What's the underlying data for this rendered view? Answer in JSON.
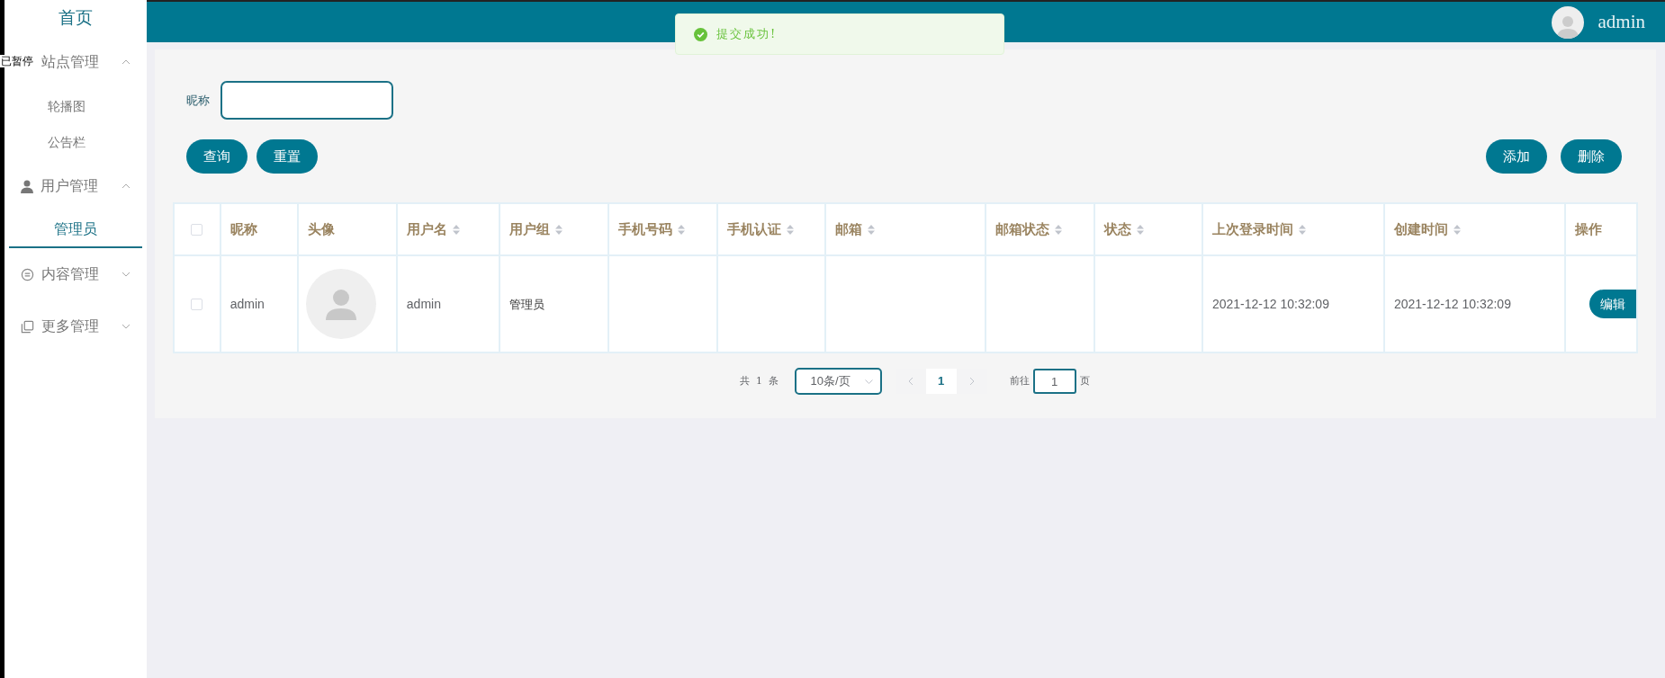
{
  "overlay_label": "已暂停",
  "sidebar": {
    "home": "首页",
    "items": [
      {
        "label": "站点管理",
        "expanded": true,
        "children": [
          {
            "label": "轮播图",
            "selected": false
          },
          {
            "label": "公告栏",
            "selected": false
          }
        ]
      },
      {
        "label": "用户管理",
        "expanded": true,
        "children": [
          {
            "label": "管理员",
            "selected": true
          }
        ]
      },
      {
        "label": "内容管理",
        "expanded": false
      },
      {
        "label": "更多管理",
        "expanded": false
      }
    ]
  },
  "header": {
    "user": "admin"
  },
  "toast": {
    "message": "提交成功!"
  },
  "search": {
    "label": "昵称"
  },
  "buttons_left": [
    "查询",
    "重置"
  ],
  "buttons_right": [
    "添加",
    "删除"
  ],
  "table": {
    "all_checked": false,
    "columns": [
      {
        "label": "昵称",
        "sortable": false
      },
      {
        "label": "头像",
        "sortable": false
      },
      {
        "label": "用户名",
        "sortable": true
      },
      {
        "label": "用户组",
        "sortable": true
      },
      {
        "label": "手机号码",
        "sortable": true
      },
      {
        "label": "手机认证",
        "sortable": true
      },
      {
        "label": "邮箱",
        "sortable": true
      },
      {
        "label": "邮箱状态",
        "sortable": true
      },
      {
        "label": "状态",
        "sortable": true
      },
      {
        "label": "上次登录时间",
        "sortable": true
      },
      {
        "label": "创建时间",
        "sortable": true
      },
      {
        "label": "操作",
        "sortable": false
      }
    ],
    "rows": [
      {
        "checked": false,
        "nickname": "admin",
        "username": "admin",
        "group": "管理员",
        "last_login": "2021-12-12 10:32:09",
        "created": "2021-12-12 10:32:09",
        "action": "编辑"
      }
    ]
  },
  "pagination": {
    "total": "共 1 条",
    "page_size": "10条/页",
    "current_page": "1",
    "goto_label": "前往",
    "goto_value": "1",
    "goto_suffix": "页"
  }
}
